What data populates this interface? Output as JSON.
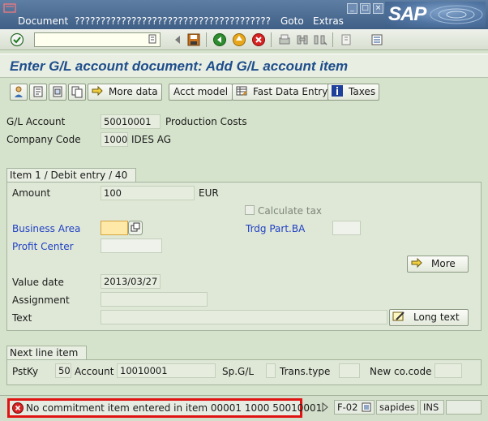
{
  "menu": {
    "items": [
      "Document",
      "??????????????????????????????????????",
      "Goto",
      "Extras"
    ],
    "logo_text": "SAP"
  },
  "title": "Enter G/L account document: Add G/L account item",
  "app_toolbar": {
    "more_data": "More data",
    "acct_model": "Acct model",
    "fast_data_entry": "Fast Data Entry",
    "taxes": "Taxes"
  },
  "header": {
    "gl_account_label": "G/L Account",
    "gl_account_value": "50010001",
    "gl_account_text": "Production Costs",
    "company_code_label": "Company Code",
    "company_code_value": "1000",
    "company_code_text": "IDES AG"
  },
  "item": {
    "group_title": "Item 1 / Debit entry / 40",
    "amount_label": "Amount",
    "amount_value": "100",
    "currency": "EUR",
    "calculate_tax_label": "Calculate tax",
    "business_area_label": "Business Area",
    "business_area_value": "",
    "trdg_part_ba_label": "Trdg Part.BA",
    "profit_center_label": "Profit Center",
    "more_button": "More",
    "value_date_label": "Value date",
    "value_date_value": "2013/03/27",
    "assignment_label": "Assignment",
    "text_label": "Text",
    "long_text_button": "Long text"
  },
  "next_line": {
    "group_title": "Next line item",
    "pstky_label": "PstKy",
    "pstky_value": "50",
    "account_label": "Account",
    "account_value": "10010001",
    "spgl_label": "Sp.G/L",
    "trans_type_label": "Trans.type",
    "new_cocode_label": "New co.code"
  },
  "status": {
    "message": "No commitment item entered in item 00001 1000 50010001",
    "transaction": "F-02",
    "server": "sapides",
    "mode": "INS"
  },
  "colors": {
    "title_blue": "#1f4e8c",
    "error_red": "#e01313",
    "label_blue": "#1f3fc4",
    "background": "#d6e3cc"
  }
}
